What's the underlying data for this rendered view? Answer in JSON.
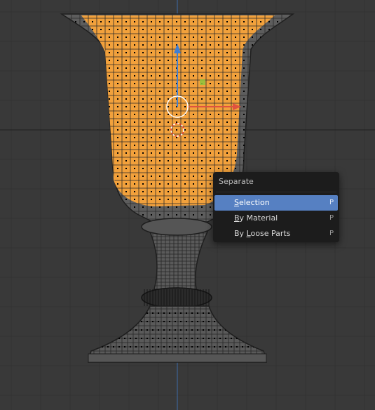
{
  "viewport": {
    "background_color": "#393939",
    "grid_color": "#323232",
    "axis_color": "#202020",
    "mesh_color": "#5d5d5d",
    "selected_color": "#f2a13c",
    "vertex_color": "#000000"
  },
  "menu": {
    "title": "Separate",
    "items": [
      {
        "underline": "S",
        "rest": "election",
        "shortcut": "P",
        "active": true
      },
      {
        "underline": "B",
        "rest": "y Material",
        "shortcut": "P",
        "active": false
      },
      {
        "prefix": "By ",
        "underline": "L",
        "rest": "oose Parts",
        "shortcut": "P",
        "active": false
      }
    ]
  }
}
